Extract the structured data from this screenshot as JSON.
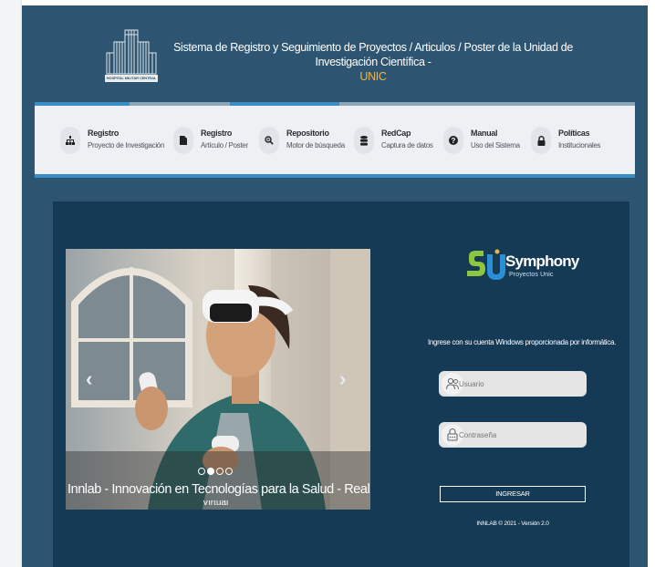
{
  "header": {
    "logo_caption": "HOSPITAL MILITAR CENTRAL",
    "title": "Sistema de Registro y Seguimiento de Proyectos / Articulos / Poster de la Unidad de Investigación Científica -",
    "title_highlight": "UNIC"
  },
  "nav": {
    "items": [
      {
        "title": "Registro",
        "sub": "Proyecto de Investigación",
        "icon": "sitemap-icon"
      },
      {
        "title": "Registro",
        "sub": "Artículo / Poster",
        "icon": "file-icon"
      },
      {
        "title": "Repositorio",
        "sub": "Motor de búsqueda",
        "icon": "search-plus-icon"
      },
      {
        "title": "RedCap",
        "sub": "Captura de datos",
        "icon": "database-icon"
      },
      {
        "title": "Manual",
        "sub": "Uso del Sistema",
        "icon": "question-circle-icon"
      },
      {
        "title": "Políticas",
        "sub": "Institucionales",
        "icon": "lock-icon"
      }
    ]
  },
  "carousel": {
    "caption": "Innlab - Innovación en Tecnologías para la Salud - Realidad",
    "caption_overflow": "Virtual",
    "prev_label": "‹",
    "next_label": "›",
    "slides": 4,
    "active_slide": 1
  },
  "login": {
    "brand_name": "Symphony",
    "brand_sub": "Proyectos Unic",
    "message": "Ingrese con su cuenta Windows proporcionada por informática.",
    "username_placeholder": "Usuario",
    "password_placeholder": "Contraseña",
    "submit_label": "INGRESAR",
    "footer": "INNLAB © 2021 - Versión 2.0"
  },
  "colors": {
    "app_bg": "#2d5571",
    "panel_bg": "#143a56",
    "accent_blue": "#3a8ec7",
    "highlight": "#f0b54a"
  }
}
